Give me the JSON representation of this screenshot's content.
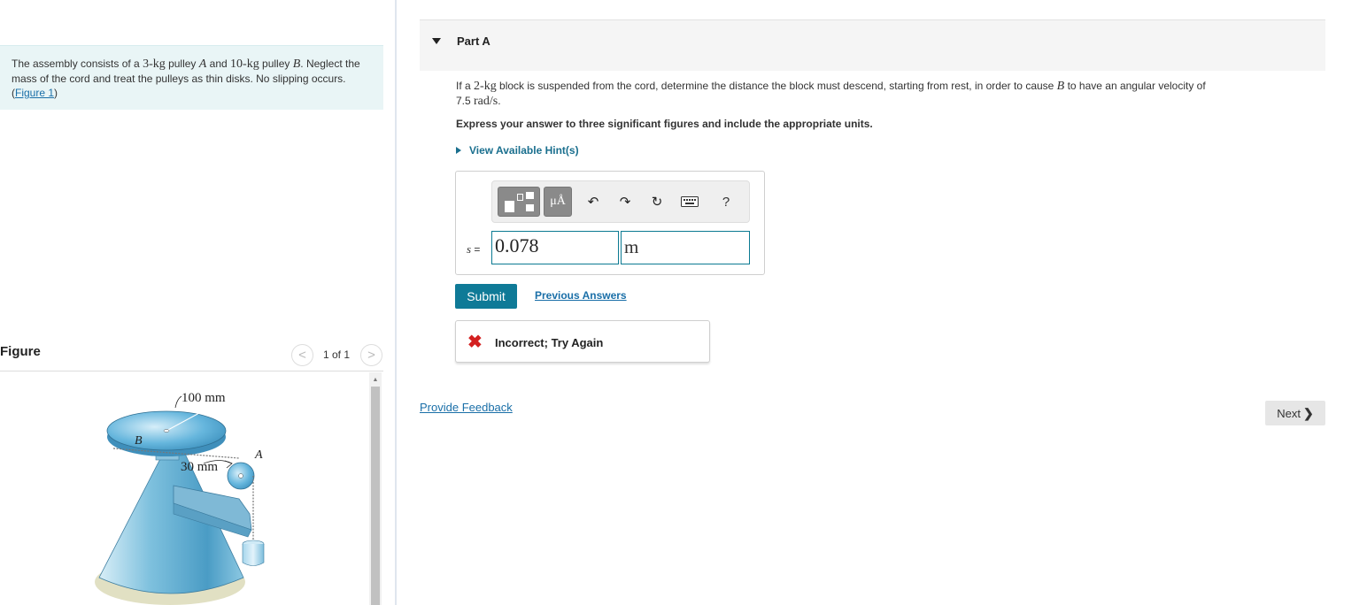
{
  "problem": {
    "text_1": "The assembly consists of a ",
    "mass_a_value": "3-",
    "mass_unit": "kg",
    "text_2": " pulley ",
    "pulley_a": "A",
    "text_3": " and ",
    "mass_b_value": "10-",
    "text_4": " pulley ",
    "pulley_b": "B",
    "text_5": ". Neglect the mass of the cord and treat the pulleys as thin disks. No slipping occurs. (",
    "figure_link": "Figure 1",
    "text_6": ")"
  },
  "figure": {
    "title": "Figure",
    "prev_symbol": "<",
    "next_symbol": ">",
    "counter": "1 of 1",
    "label_radius_b": "100 mm",
    "label_b": "B",
    "label_radius_a": "30 mm",
    "label_a": "A"
  },
  "part": {
    "title": "Part A"
  },
  "question": {
    "text_1": "If a ",
    "block_mass": "2-",
    "mass_unit": "kg",
    "text_2": " block is suspended from the cord, determine the distance the block must descend, starting from rest, in order to cause ",
    "pulley_b": "B",
    "text_3": " to have an angular velocity of ",
    "omega_value": "7.5 ",
    "omega_unit": "rad/s",
    "text_4": "."
  },
  "instruction": "Express your answer to three significant figures and include the appropriate units.",
  "hint_link": "View Available Hint(s)",
  "toolbar": {
    "units_label": "μÅ",
    "undo_icon": "↶",
    "redo_icon": "↷",
    "reset_icon": "↻",
    "help_label": "?"
  },
  "answer": {
    "variable": "s",
    "equals": " =",
    "value": "0.078",
    "unit": "m"
  },
  "submit_label": "Submit",
  "previous_answers_label": "Previous Answers",
  "feedback": {
    "icon": "✖",
    "message": "Incorrect; Try Again"
  },
  "provide_feedback_label": "Provide Feedback",
  "next_label": "Next",
  "next_chevron": "❯",
  "colors": {
    "problem_bg": "#e9f5f6",
    "accent": "#0f7a97",
    "link": "#1a6fa8",
    "error": "#d32020"
  }
}
